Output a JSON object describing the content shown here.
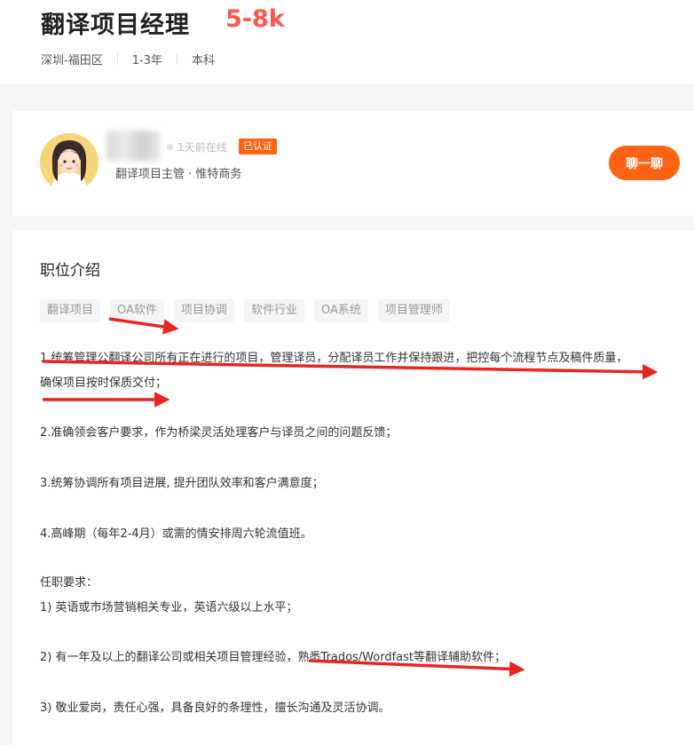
{
  "job": {
    "title": "翻译项目经理",
    "salary": "5-8k",
    "location": "深圳-福田区",
    "experience": "1-3年",
    "degree": "本科"
  },
  "recruiter": {
    "online_status": "1天前在线",
    "verified_badge": "已认证",
    "info": "翻译项目主管 · 惟特商务",
    "chat_button": "聊一聊"
  },
  "description": {
    "section_title": "职位介绍",
    "tags": [
      "翻译项目",
      "OA软件",
      "项目协调",
      "软件行业",
      "OA系统",
      "项目管理师"
    ],
    "lines": [
      "1.统筹管理公翻译公司所有正在进行的项目，管理译员，分配译员工作并保持跟进，把控每个流程节点及稿件质量，",
      "确保项目按时保质交付；",
      "2.准确领会客户要求，作为桥梁灵活处理客户与译员之间的问题反馈；",
      "3.统筹协调所有项目进展, 提升团队效率和客户满意度；",
      "4.高峰期（每年2-4月）或需的情安排周六轮流值班。",
      "任职要求：",
      "1) 英语或市场营销相关专业，英语六级以上水平；",
      "2) 有一年及以上的翻译公司或相关项目管理经验，熟悉Trados/Wordfast等翻译辅助软件；",
      "3) 敬业爱岗，责任心强，具备良好的条理性，擅长沟通及灵活协调。"
    ]
  },
  "colors": {
    "accent": "#fe6214",
    "salary": "#fe574a",
    "annotation_red": "#e8251f"
  }
}
